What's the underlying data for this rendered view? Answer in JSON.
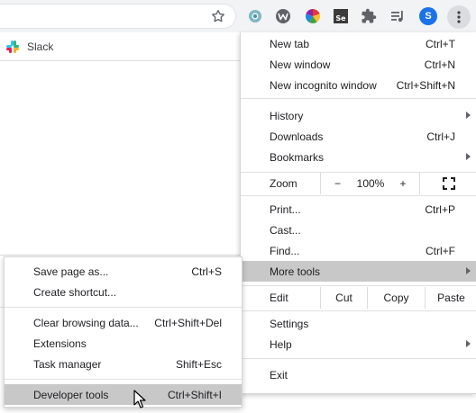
{
  "toolbar": {
    "profile_initial": "S",
    "extensions": [
      "extension-blue-ring-icon",
      "extension-w-logo-icon",
      "extension-color-wheel-icon",
      "selenium-ide-icon",
      "extensions-puzzle-icon",
      "media-queue-icon"
    ],
    "selenium_badge": "Se"
  },
  "bookmarks": [
    {
      "label": "Slack",
      "icon": "slack-icon"
    }
  ],
  "main_menu": {
    "new_tab": {
      "label": "New tab",
      "shortcut": "Ctrl+T"
    },
    "new_window": {
      "label": "New window",
      "shortcut": "Ctrl+N"
    },
    "new_incognito": {
      "label": "New incognito window",
      "shortcut": "Ctrl+Shift+N"
    },
    "history": {
      "label": "History"
    },
    "downloads": {
      "label": "Downloads",
      "shortcut": "Ctrl+J"
    },
    "bookmarks": {
      "label": "Bookmarks"
    },
    "zoom": {
      "label": "Zoom",
      "minus": "−",
      "value": "100%",
      "plus": "+"
    },
    "print": {
      "label": "Print...",
      "shortcut": "Ctrl+P"
    },
    "cast": {
      "label": "Cast..."
    },
    "find": {
      "label": "Find...",
      "shortcut": "Ctrl+F"
    },
    "more_tools": {
      "label": "More tools"
    },
    "edit": {
      "label": "Edit",
      "cut": "Cut",
      "copy": "Copy",
      "paste": "Paste"
    },
    "settings": {
      "label": "Settings"
    },
    "help": {
      "label": "Help"
    },
    "exit": {
      "label": "Exit"
    }
  },
  "more_tools_menu": {
    "save_page": {
      "label": "Save page as...",
      "shortcut": "Ctrl+S"
    },
    "create_shortcut": {
      "label": "Create shortcut..."
    },
    "clear_data": {
      "label": "Clear browsing data...",
      "shortcut": "Ctrl+Shift+Del"
    },
    "extensions": {
      "label": "Extensions"
    },
    "task_manager": {
      "label": "Task manager",
      "shortcut": "Shift+Esc"
    },
    "developer_tools": {
      "label": "Developer tools",
      "shortcut": "Ctrl+Shift+I"
    }
  },
  "colors": {
    "highlight": "#c8c8c8",
    "toolbar_bg": "#f1f3f4",
    "profile_blue": "#1a73e8"
  }
}
